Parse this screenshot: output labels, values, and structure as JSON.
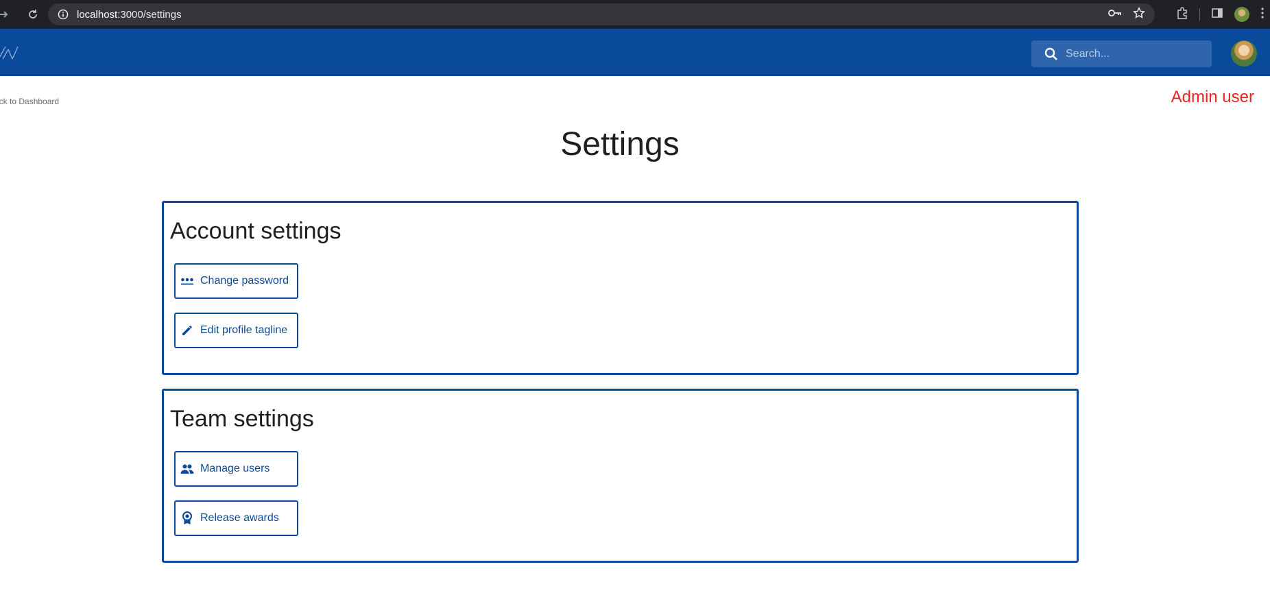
{
  "browser": {
    "url_host": "localhost",
    "url_path": ":3000/settings"
  },
  "header": {
    "search_placeholder": "Search..."
  },
  "page": {
    "back_link": "ack to Dashboard",
    "role_label": "Admin user",
    "title": "Settings"
  },
  "sections": {
    "account": {
      "title": "Account settings",
      "buttons": [
        "Change password",
        "Edit profile tagline"
      ]
    },
    "team": {
      "title": "Team settings",
      "buttons": [
        "Manage users",
        "Release awards"
      ]
    }
  },
  "colors": {
    "brand": "#0a4a9b",
    "admin_label": "#ee2222"
  },
  "icons": {
    "change_password": "password-dots-icon",
    "edit_tagline": "pencil-icon",
    "manage_users": "people-icon",
    "release_awards": "award-badge-icon"
  }
}
